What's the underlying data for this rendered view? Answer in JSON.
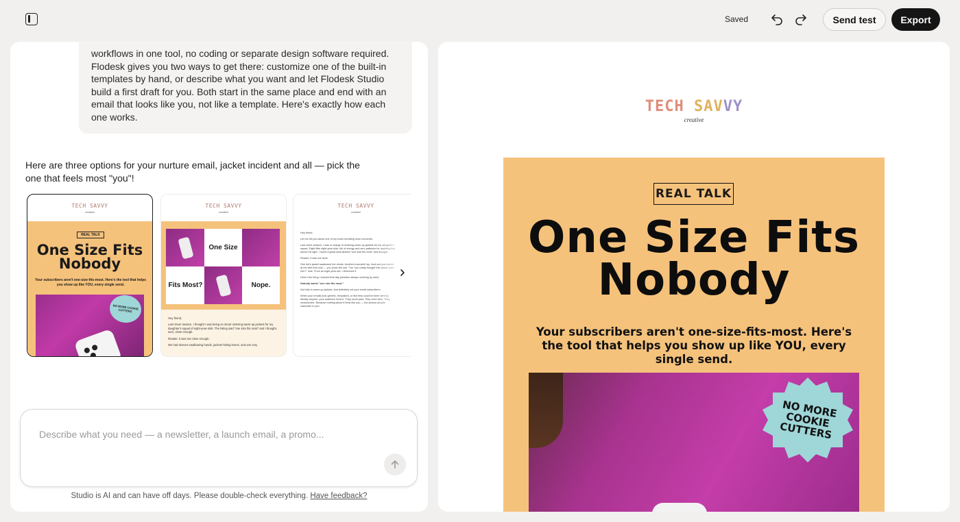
{
  "toolbar": {
    "saved_label": "Saved",
    "send_test_label": "Send test",
    "export_label": "Export"
  },
  "chat": {
    "user_message": "workflows in one tool, no coding or separate design software required. Flodesk gives you two ways to get there: customize one of the built-in templates by hand, or describe what you want and let Flodesk Studio build a first draft for you. Both start in the same place and end with an email that looks like you, not like a template. Here's exactly how each one works.",
    "ai_message": "Here are three options for your nurture email, jacket incident and all — pick the one that feels most \"you\"!",
    "options": [
      {
        "logo": "TECH SAVVY",
        "logo_sub": "creative",
        "tag": "REAL TALK",
        "title": "One Size Fits Nobody",
        "desc": "Your subscribers aren't one-size-fits-most. Here's the tool that helps you show up like YOU, every single send.",
        "badge": "NO MORE COOKIE CUTTERS"
      },
      {
        "logo": "TECH SAVVY",
        "logo_sub": "creative",
        "cell_one_size": "One Size",
        "cell_fits_most": "Fits Most?",
        "cell_nope": "Nope.",
        "body_greeting": "Hey friend,",
        "body_p1": "Last cheer season, I thought I was being so smart ordering warm-up jackets for my daughter's squad of eight-year-olds. The listing said \"one size fits most\" and I thought, sure, close enough.",
        "body_p2": "Reader, it was not close enough.",
        "body_p3": "We had sleeves swallowing hands, jackets hitting knees, and one very"
      },
      {
        "logo": "TECH SAVVY",
        "logo_sub": "creative",
        "lines": [
          "Hey friend,",
          "Let me tell you about one of my most humbling mom moments.",
          "Last cheer season, I was in charge of ordering warm-up jackets for my daughter's squad. Eight little eight-year-olds, full of energy and zero patience for anything that doesn't fit right. I found a great deal labeled \"one size fits most\" and thought...",
          "Reader, it was not done.",
          "One kid's jacket swallowed her whole. Another's wouldn't zip. And one just stared at me with that look — you know the one. The \"you really thought this would work, huh?\" look. From an eight-year-old. I deserved it.",
          "Here's the thing I learned that day (besides always ordering by size):",
          "Nobody wants \"one size fits most.\"",
          "Not kids in warm-up jackets. And definitely not your email subscribers.",
          "When your emails look generic, templated, or like they could've been sent by literally anyone, your audience feels it. They scroll past. They don't click. They unsubscribe. Because nothing about it feels like you — the person people subscribe to you"
        ]
      }
    ],
    "composer_placeholder": "Describe what you need — a newsletter, a launch email, a promo...",
    "disclaimer": "Studio is AI and can have off days. Please double-check everything.",
    "feedback_link": "Have feedback?"
  },
  "preview": {
    "logo_letters": [
      "TECH",
      " ",
      "SAV",
      "VY"
    ],
    "logo_sub": "creative",
    "tag": "REAL TALK",
    "title_line1": "One Size Fits",
    "title_line2": "Nobody",
    "desc": "Your subscribers aren't one-size-fits-most. Here's the tool that helps you show up like YOU, every single send.",
    "badge": "NO MORE COOKIE CUTTERS"
  },
  "colors": {
    "hero_bg": "#f5c27c",
    "badge_bg": "#9fd6d8",
    "export_bg": "#151515",
    "photo_magenta": "#c43da9"
  },
  "icons": [
    "sidebar-toggle-icon",
    "undo-icon",
    "redo-icon",
    "chevron-right-icon",
    "arrow-up-icon"
  ]
}
